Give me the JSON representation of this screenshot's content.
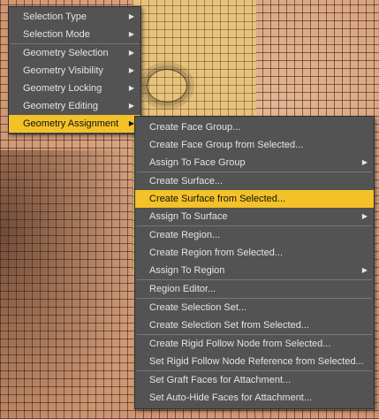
{
  "main_menu": {
    "items": [
      {
        "label": "Selection Type"
      },
      {
        "label": "Selection Mode"
      },
      {
        "label": "Geometry Selection"
      },
      {
        "label": "Geometry Visibility"
      },
      {
        "label": "Geometry Locking"
      },
      {
        "label": "Geometry Editing"
      },
      {
        "label": "Geometry Assignment"
      }
    ],
    "active_item": "Geometry Assignment"
  },
  "submenu": {
    "items": [
      {
        "label": "Create Face Group..."
      },
      {
        "label": "Create Face Group from Selected..."
      },
      {
        "label": "Assign To Face Group"
      },
      {
        "label": "Create Surface..."
      },
      {
        "label": "Create Surface from Selected..."
      },
      {
        "label": "Assign To Surface"
      },
      {
        "label": "Create Region..."
      },
      {
        "label": "Create Region from Selected..."
      },
      {
        "label": "Assign To Region"
      },
      {
        "label": "Region Editor..."
      },
      {
        "label": "Create Selection Set..."
      },
      {
        "label": "Create Selection Set from Selected..."
      },
      {
        "label": "Create Rigid Follow Node from Selected..."
      },
      {
        "label": "Set Rigid Follow Node Reference from Selected..."
      },
      {
        "label": "Set Graft Faces for Attachment..."
      },
      {
        "label": "Set Auto-Hide Faces for Attachment..."
      }
    ],
    "highlighted_item": "Create Surface from Selected..."
  },
  "submenu_arrow_glyph": "▶",
  "colors": {
    "menu_bg": "#535353",
    "highlight": "#f3c128",
    "menu_text": "#e4e4e4"
  }
}
